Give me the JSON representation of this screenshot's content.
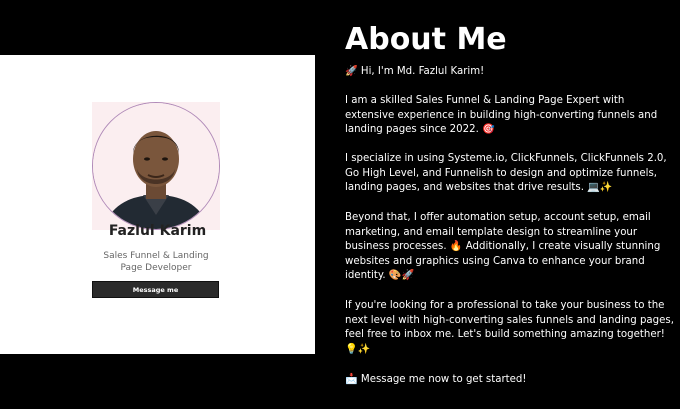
{
  "profile": {
    "name": "Fazlul Karim",
    "role": "Sales Funnel & Landing Page Developer",
    "button_label": "Message  me"
  },
  "about": {
    "heading": "About Me",
    "greeting": "🚀 Hi, I'm Md. Fazlul Karim!",
    "paragraph_1": "I am a skilled Sales Funnel & Landing Page Expert with extensive experience in building high-converting funnels and landing pages since 2022. 🎯",
    "paragraph_2": "I specialize in using Systeme.io, ClickFunnels, ClickFunnels 2.0, Go High Level, and Funnelish to design and optimize funnels, landing pages, and websites that drive results. 💻✨",
    "paragraph_3": "Beyond that, I offer automation setup, account setup, email marketing, and email template design to streamline your business processes. 🔥 Additionally, I create visually stunning websites and graphics using Canva to enhance your brand identity. 🎨🚀",
    "paragraph_4": "If you're looking for a professional to take your business to the next level with high-converting sales funnels and landing pages, feel free to inbox me. Let's build something amazing together! 💡✨",
    "cta": "📩 Message me now to get started!"
  },
  "colors": {
    "background": "#000000",
    "card": "#ffffff",
    "button": "#2b2b2b",
    "ring": "#b08ab8"
  }
}
